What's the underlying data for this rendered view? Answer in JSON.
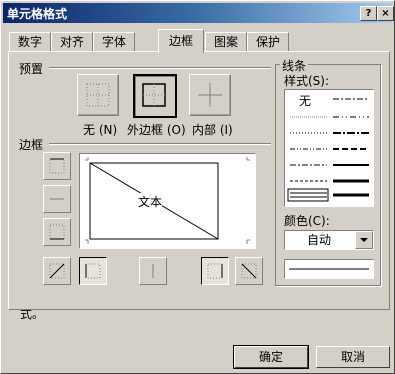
{
  "window": {
    "title": "单元格格式"
  },
  "titlebar_buttons": {
    "help": "?",
    "close": "×"
  },
  "tabs": [
    {
      "label": "数字"
    },
    {
      "label": "对齐"
    },
    {
      "label": "字体"
    },
    {
      "label": "边框",
      "active": true
    },
    {
      "label": "图案"
    },
    {
      "label": "保护"
    }
  ],
  "presets": {
    "heading": "预置",
    "none_label": "无 (N)",
    "outline_label": "外边框 (O)",
    "inside_label": "内部 (I)"
  },
  "border": {
    "heading": "边框",
    "preview_text": "文本"
  },
  "line": {
    "heading": "线条",
    "style_label": "样式(S):",
    "none_option": "无",
    "color_label": "颜色(C):",
    "color_value": "自动",
    "color_dropdown_icon": "triangle-down"
  },
  "description": "单击预置选项、预览草图及上面的按钮可以添加边框样式。",
  "buttons": {
    "ok": "确定",
    "cancel": "取消"
  }
}
